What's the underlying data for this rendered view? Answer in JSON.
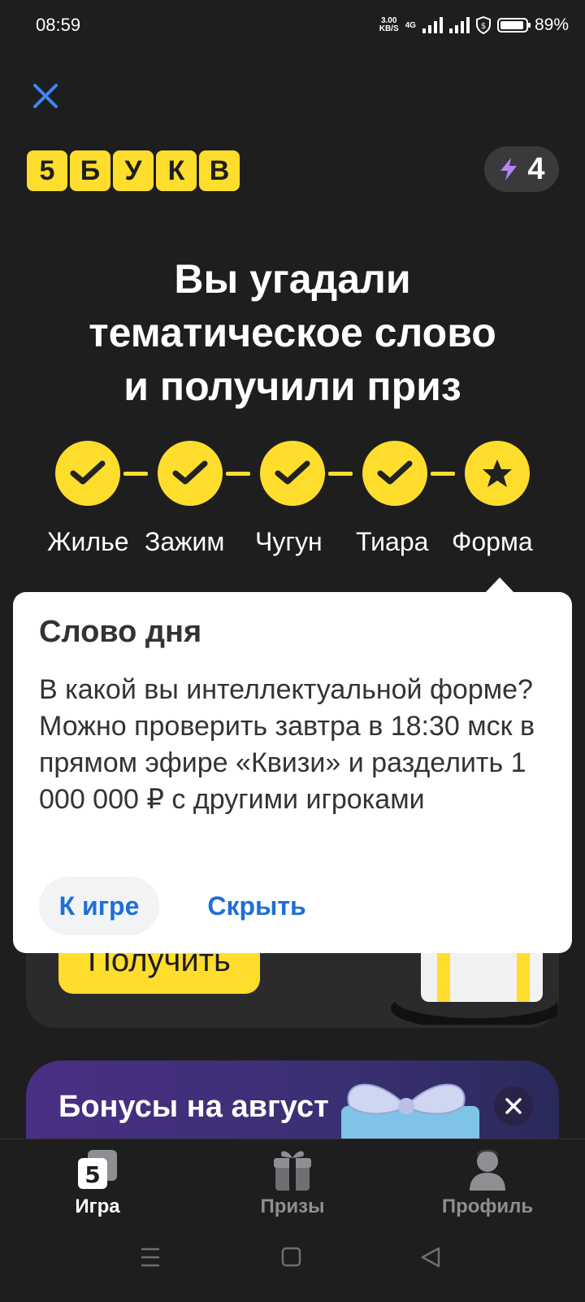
{
  "status_bar": {
    "time": "08:59",
    "net_speed_value": "3.00",
    "net_speed_unit": "KB/S",
    "network": "4G",
    "battery": "89%"
  },
  "header": {
    "logo_letters": [
      "5",
      "Б",
      "У",
      "К",
      "В"
    ],
    "energy_count": "4"
  },
  "headline": [
    "Вы угадали",
    "тематическое слово",
    "и получили приз"
  ],
  "progress": {
    "words": [
      "Жилье",
      "Зажим",
      "Чугун",
      "Тиара",
      "Форма"
    ],
    "states": [
      "check",
      "check",
      "check",
      "check",
      "star"
    ]
  },
  "popup": {
    "title": "Слово дня",
    "text": "В какой вы интеллектуальной форме? Можно проверить завтра в 18:30 мск в прямом эфире «Квизи» и разделить 1 000 000 ₽ с другими игроками",
    "primary_button": "К игре",
    "secondary_button": "Скрыть"
  },
  "prize_card": {
    "button": "Получить"
  },
  "bonus_card": {
    "title": "Бонусы на август"
  },
  "bottom_nav": {
    "items": [
      {
        "label": "Игра",
        "icon": "game-icon",
        "active": true
      },
      {
        "label": "Призы",
        "icon": "gift-icon",
        "active": false
      },
      {
        "label": "Профиль",
        "icon": "profile-icon",
        "active": false
      }
    ]
  },
  "colors": {
    "background": "#1e1e1f",
    "accent_yellow": "#ffdd2d",
    "link_blue": "#1f6fd6",
    "popup_bg": "#ffffff"
  }
}
